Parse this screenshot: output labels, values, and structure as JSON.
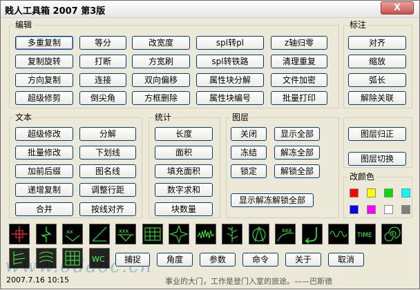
{
  "window": {
    "title": "贱人工具箱 2007  第3版",
    "close_label": "X"
  },
  "groups": {
    "edit": "编辑",
    "mark": "标注",
    "text": "文本",
    "stats": "统计",
    "layer": "图层",
    "color": "改颜色"
  },
  "edit_buttons": [
    "多重复制",
    "等分",
    "改宽度",
    "spl转pl",
    "z轴归零",
    "复制旋转",
    "打断",
    "方宽刷",
    "spl转铁路",
    "清理重复",
    "方向复制",
    "连接",
    "双向偏移",
    "属性块分解",
    "文件加密",
    "超级修剪",
    "倒尖角",
    "方框删除",
    "属性块编号",
    "批量打印"
  ],
  "mark_buttons": [
    "对齐",
    "缩放",
    "弧长",
    "解除关联"
  ],
  "text_buttons": [
    "超级修改",
    "分解",
    "批量修改",
    "下划线",
    "加前后缀",
    "图名线",
    "递增复制",
    "调整行距",
    "合并",
    "按线对齐"
  ],
  "stats_buttons": [
    "长度",
    "面积",
    "填充面积",
    "数字求和",
    "块数量"
  ],
  "layer_buttons": [
    "关闭",
    "显示全部",
    "冻结",
    "解冻全部",
    "锁定",
    "解锁全部"
  ],
  "layer_show_all_label": "显示解冻解锁全部",
  "layer_side_buttons": [
    "图层归正",
    "图层切换"
  ],
  "colors": [
    "#ff0000",
    "#ffff00",
    "#00dd00",
    "#00ffff",
    "#0000ff",
    "#ff00ff",
    "#ffffff",
    "#808080"
  ],
  "icon_names": [
    "crosshair-icon",
    "zigzag-icon",
    "xx-marker-icon",
    "angle-icon",
    "xxx-line-icon",
    "table-icon",
    "star-icon",
    "noise-wave-icon",
    "tree-icon",
    "compass-icon",
    "xxx-curve-icon",
    "arrow-u-turn-icon",
    "square-wave-icon",
    "time-text-icon",
    "spiral-icon"
  ],
  "bottom_buttons": [
    "捕捉",
    "角度",
    "参数",
    "命令",
    "关于",
    "取消"
  ],
  "status": {
    "datetime": "2007.7.16  10:15",
    "motto": "事业的大门，工作是登门入室的旅途。——巴斯德"
  },
  "watermark": "www.0daoc.cn"
}
